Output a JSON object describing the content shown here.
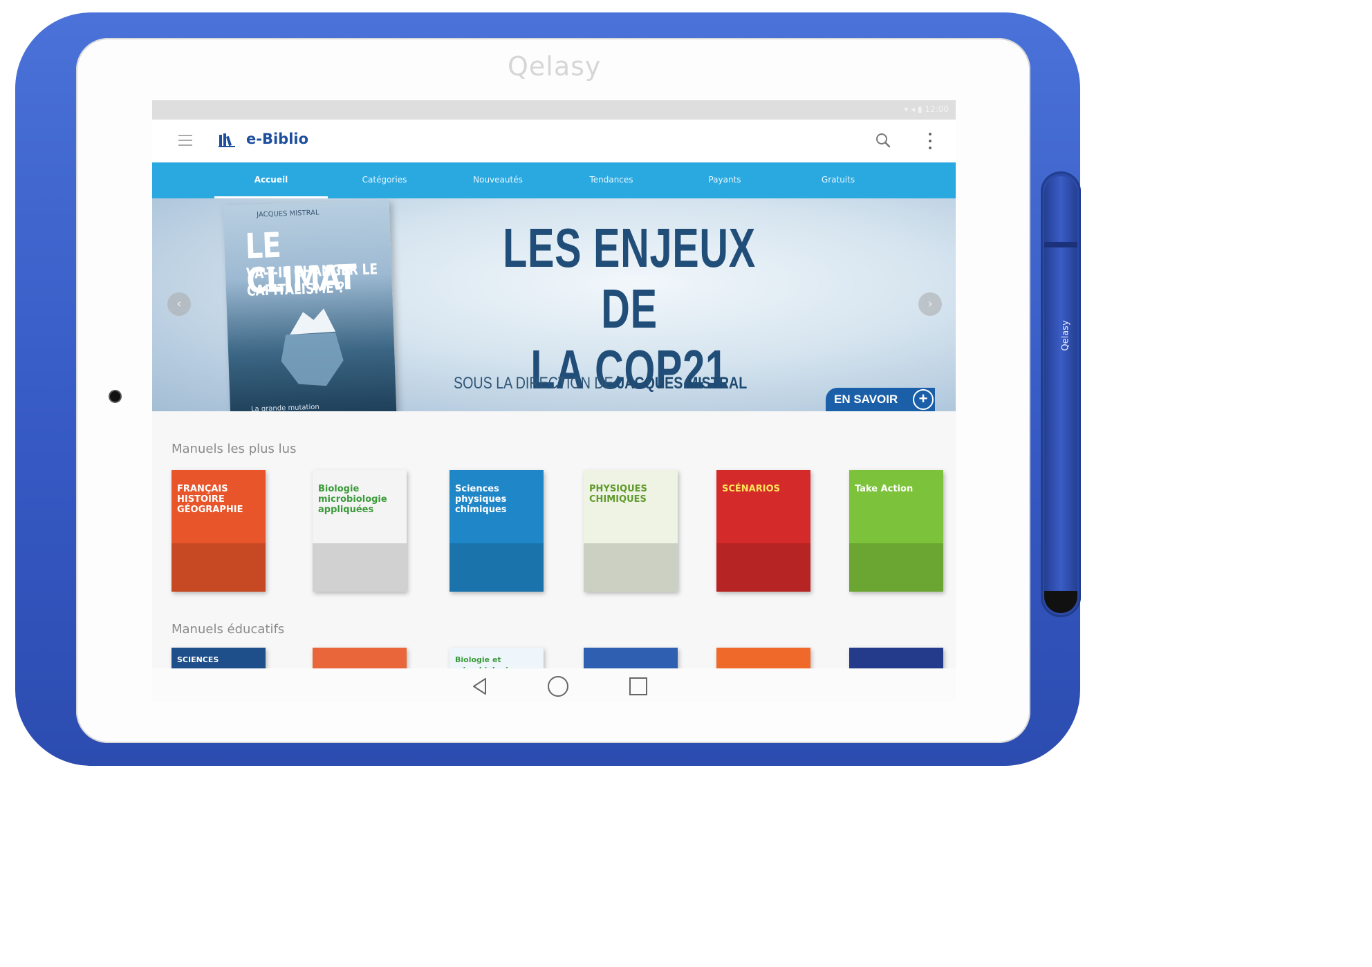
{
  "device": {
    "brand": "Qelasy",
    "stylus_label": "Qelasy"
  },
  "status_bar": {
    "text": "▾ ◂ ▮ 12:00"
  },
  "app_bar": {
    "menu_icon": "hamburger-menu-icon",
    "logo_icon": "library-books-icon",
    "title": "e-Biblio",
    "search_icon": "search-icon",
    "more_icon": "more-vertical-icon"
  },
  "tabs": [
    {
      "label": "Accueil",
      "active": true
    },
    {
      "label": "Catégories",
      "active": false
    },
    {
      "label": "Nouveautés",
      "active": false
    },
    {
      "label": "Tendances",
      "active": false
    },
    {
      "label": "Payants",
      "active": false
    },
    {
      "label": "Gratuits",
      "active": false
    }
  ],
  "banner": {
    "book": {
      "author": "JACQUES MISTRAL",
      "title": "LE CLIMAT",
      "subtitle": "VA-T-IL CHANGER LE CAPITALISME ?",
      "footer": "La grande mutation"
    },
    "headline_line1": "LES ENJEUX DE",
    "headline_line2": "LA COP21",
    "byline_prefix": "SOUS LA DIRECTION DE",
    "byline_name": "JACQUES MISTRAL",
    "cta_label": "EN SAVOIR",
    "cta_icon": "plus-icon",
    "prev_icon": "chevron-left-icon",
    "next_icon": "chevron-right-icon",
    "prev_glyph": "‹",
    "next_glyph": "›",
    "plus_glyph": "+"
  },
  "sections": [
    {
      "title": "Manuels les plus lus",
      "books": [
        {
          "title": "FRANÇAIS HISTOIRE GÉOGRAPHIE",
          "bg": "#e8552a",
          "fg": "#ffffff"
        },
        {
          "title": "Biologie microbiologie appliquées",
          "bg": "#f4f4f4",
          "fg": "#3a9a3a"
        },
        {
          "title": "Sciences physiques chimiques",
          "bg": "#1f86c8",
          "fg": "#ffffff"
        },
        {
          "title": "PHYSIQUES CHIMIQUES",
          "bg": "#eef3e4",
          "fg": "#5f9a2a"
        },
        {
          "title": "SCÉNARIOS",
          "bg": "#d52a2a",
          "fg": "#ffe45a"
        },
        {
          "title": "Take Action",
          "bg": "#7cc23a",
          "fg": "#ffffff"
        }
      ]
    },
    {
      "title": "Manuels éducatifs",
      "books": [
        {
          "title": "SCIENCES",
          "bg": "#1f4f8a",
          "fg": "#ffffff"
        },
        {
          "title": "",
          "bg": "#e8663a",
          "fg": "#ffffff"
        },
        {
          "title": "Biologie et microbiologie",
          "bg": "#eef5fb",
          "fg": "#3a9a3a"
        },
        {
          "title": "",
          "bg": "#2f5fb0",
          "fg": "#ffffff"
        },
        {
          "title": "",
          "bg": "#ef6a2a",
          "fg": "#ffffff"
        },
        {
          "title": "",
          "bg": "#243a8a",
          "fg": "#ffffff"
        }
      ]
    }
  ],
  "nav_bar": {
    "back_icon": "back-triangle-icon",
    "home_icon": "home-circle-icon",
    "recent_icon": "recent-apps-square-icon"
  }
}
